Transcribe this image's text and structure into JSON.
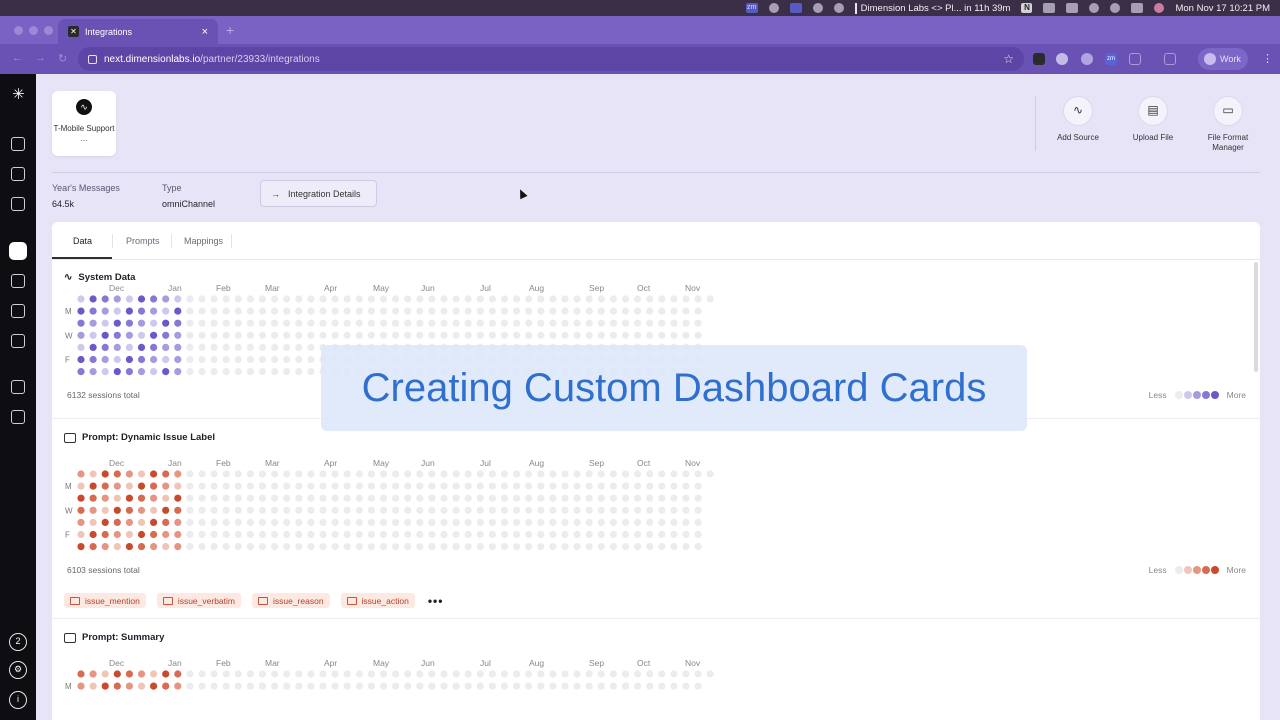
{
  "menubar": {
    "event": "Dimension Labs <> Pl... in 11h 39m",
    "datetime": "Mon Nov 17  10:21 PM",
    "noti_label": "N",
    "zoom_label": "zm"
  },
  "browser": {
    "tab_title": "Integrations",
    "tab_close": "×",
    "new_tab": "+",
    "url_host": "next.dimensionlabs.io",
    "url_path": "/partner/23933/integrations",
    "profile_label": "Work",
    "ext_zoom_label": "zm"
  },
  "rail": {
    "badge_count": "2"
  },
  "source": {
    "name": "T-Mobile Support ...",
    "icon": "waveform-icon"
  },
  "actions": [
    {
      "label": "Add Source",
      "icon": "add-source-icon"
    },
    {
      "label": "Upload File",
      "icon": "upload-file-icon"
    },
    {
      "label": "File Format Manager",
      "icon": "file-format-icon"
    }
  ],
  "meta": {
    "messages_label": "Year's Messages",
    "messages_value": "64.5k",
    "type_label": "Type",
    "type_value": "omniChannel",
    "details_button": "Integration Details"
  },
  "tabs": [
    "Data",
    "Prompts",
    "Mappings"
  ],
  "months": [
    "Dec",
    "Jan",
    "Feb",
    "Mar",
    "Apr",
    "May",
    "Jun",
    "Jul",
    "Aug",
    "Sep",
    "Oct",
    "Nov"
  ],
  "weekday_labels": [
    "M",
    "W",
    "F"
  ],
  "sections": [
    {
      "title": "System Data",
      "total": "6132 sessions total",
      "colors": [
        "#ececef",
        "#cfc8ee",
        "#a79be0",
        "#8877d6",
        "#6c59c9"
      ]
    },
    {
      "title": "Prompt: Dynamic Issue Label",
      "total": "6103 sessions total",
      "colors": [
        "#ececef",
        "#f1c4b8",
        "#e59582",
        "#d86a4f",
        "#c84a2a"
      ]
    },
    {
      "title": "Prompt: Summary",
      "total": "",
      "colors": [
        "#ececef",
        "#f1c4b8",
        "#e59582",
        "#d86a4f",
        "#c84a2a"
      ]
    }
  ],
  "legend": {
    "less": "Less",
    "more": "More"
  },
  "chips": [
    "issue_mention",
    "issue_verbatim",
    "issue_reason",
    "issue_action"
  ],
  "chips_more": "•••",
  "overlay_title": "Creating Custom Dashboard Cards"
}
